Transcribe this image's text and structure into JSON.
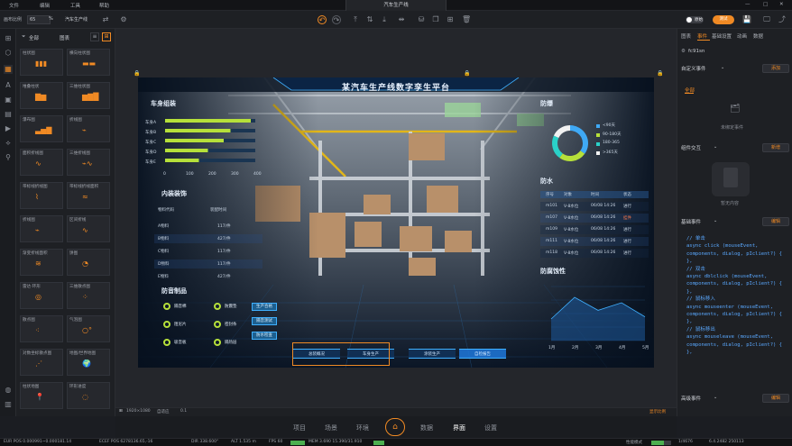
{
  "menu": {
    "items": [
      "文件",
      "编辑",
      "工具",
      "帮助"
    ],
    "doc_title": "汽车生产线"
  },
  "toolbar": {
    "zoom_label": "画布比例",
    "zoom_value": "65",
    "zoom_unit": "%",
    "project_name": "汽车生产线",
    "toggle_label": "原始",
    "beta_label": "测试"
  },
  "left_panel": {
    "tab_active": "图表",
    "tab_other": "全部",
    "tiles": [
      "柱状图",
      "横向柱状图",
      "堆叠柱状",
      "三维柱状图",
      "瀑布图",
      "折线图",
      "面积折线图",
      "三维折线图",
      "带标线折线图",
      "带标线折线面积",
      "折线图",
      "区间折线",
      "渐变折线面积",
      "饼图",
      "雷达·环形",
      "三维散点图",
      "散点图",
      "气泡图",
      "对数坐标散点图",
      "地图/世界地图",
      "柱状地图",
      "环形进度"
    ]
  },
  "screen": {
    "title": "某汽车生产线数字孪生平台",
    "sec_body": "车身组装",
    "body_rows": [
      "车身A",
      "车身B",
      "车身C",
      "车身D",
      "车身E"
    ],
    "body_values": [
      95,
      72,
      64,
      48,
      38
    ],
    "body_axis": [
      "0",
      "100",
      "200",
      "300",
      "400"
    ],
    "sec_interior": "内装装饰",
    "interior_header": [
      "物料代码",
      "装配时间"
    ],
    "interior_rows": [
      [
        "A物料",
        "117/件"
      ],
      [
        "B物料",
        "427/件"
      ],
      [
        "C物料",
        "117/件"
      ],
      [
        "D物料",
        "117/件"
      ],
      [
        "E物料",
        "427/件"
      ]
    ],
    "sec_noise": "防音制品",
    "noise_items": [
      "隔音棉",
      "防震垫",
      "阻尼片",
      "密封条",
      "吸音板",
      "隔热层"
    ],
    "noise_pills": [
      "生产合格",
      "隔音测试",
      "防水检查"
    ],
    "sec_proof": "防爆",
    "proof_legend": [
      "<90天",
      "90-180天",
      "180-365",
      ">365天"
    ],
    "sec_water": "防水",
    "water_header": [
      "序号",
      "对象",
      "时间",
      "状态"
    ],
    "water_rows": [
      [
        "m101",
        "V-8水位",
        "06/08 14:26",
        "进行"
      ],
      [
        "m107",
        "V-8水位",
        "06/08 14:26",
        "挂件"
      ],
      [
        "m109",
        "V-8水位",
        "06/08 14:26",
        "进行"
      ],
      [
        "m111",
        "V-8水位",
        "06/08 14:26",
        "进行"
      ],
      [
        "m118",
        "V-8水位",
        "06/08 14:26",
        "进行"
      ]
    ],
    "sec_rust": "防腐蚀性",
    "rust_months": [
      "1月",
      "2月",
      "3月",
      "4月",
      "5月"
    ],
    "nav": [
      "总装概况",
      "车身生产",
      "涂装生产",
      "自检报告"
    ]
  },
  "chart_data": [
    {
      "type": "bar",
      "categories": [
        "车身A",
        "车身B",
        "车身C",
        "车身D",
        "车身E"
      ],
      "values": [
        380,
        290,
        260,
        190,
        150
      ],
      "xlim": [
        0,
        400
      ]
    },
    {
      "type": "pie",
      "categories": [
        "<90天",
        "90-180天",
        "180-365",
        ">365天"
      ],
      "values": [
        35,
        25,
        22,
        18
      ],
      "colors": [
        "#3fa9f5",
        "#b6e03a",
        "#2ad1c8",
        "#f2f2f2"
      ]
    },
    {
      "type": "area",
      "categories": [
        "1月",
        "2月",
        "3月",
        "4月",
        "5月"
      ],
      "values": [
        20,
        40,
        28,
        35,
        22
      ],
      "ylim": [
        0,
        50
      ]
    }
  ],
  "canvas_footer": {
    "size": "1920×1080",
    "scale": "自适应",
    "zoom": "0.1",
    "right_link": "显示比例"
  },
  "right_panel": {
    "tabs": [
      "图表",
      "事件",
      "基础设置",
      "动画",
      "数据"
    ],
    "widget_id": "fc91sn",
    "custom_events": "自定义事件",
    "add_label": "添加",
    "filter_all": "全部",
    "empty_event": "未绑定事件",
    "component_interaction": "组件交互",
    "new_label": "新增",
    "no_content": "暂无内容",
    "basic_events": "基础事件",
    "edit_label": "编辑",
    "code": "// 单击\nasync click (mouseEvent,\ncomponents, dialog, pIclient?) {\n},\n// 双击\nasync dblclick (mouseEvent,\ncomponents, dialog, pIclient?) {\n},\n// 鼠标移入\nasync mouseenter (mouseEvent,\ncomponents, dialog, pIclient?) {\n},\n// 鼠标移出\nasync mouseleave (mouseEvent,\ncomponents, dialog, pIclient?) {\n},",
    "advanced_events": "高级事件"
  },
  "bottom_nav": [
    "项目",
    "场景",
    "环境",
    "数据",
    "界面",
    "设置"
  ],
  "statusbar": {
    "fps_pos": "EUR POS 0.000991~0.000181.14",
    "ecef": "ECEF POS 6278136.65,-16",
    "dir": "DIR 338.600°",
    "alt": "ALT 1.535 m",
    "fps": "FPS 60",
    "mem": "MEM 3.690 15.390/31.910",
    "mode": "性能模式",
    "ver": "1/4676",
    "build": "6.4.2482 250113"
  },
  "colors": {
    "accent": "#f08a24",
    "bar": "#b6e03a",
    "cyan": "#3fb0ff"
  }
}
